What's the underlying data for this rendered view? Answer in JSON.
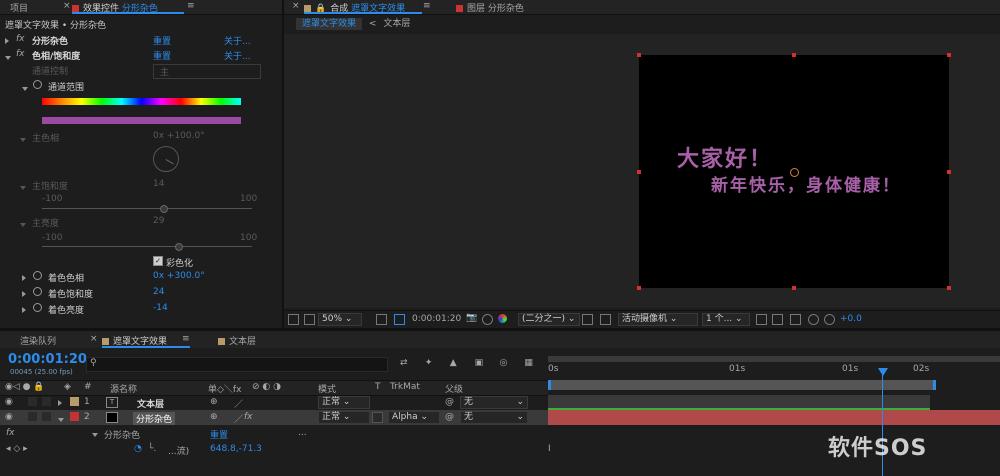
{
  "effects_panel": {
    "tab_project": "项目",
    "tab_effect_controls": "效果控件",
    "tab_layer_name": "分形杂色",
    "menu_glyph": "≡",
    "breadcrumb": "遮罩文字效果 • 分形杂色",
    "effects": [
      {
        "fx": "fx",
        "name": "分形杂色",
        "reset": "重置",
        "about": "关于..."
      },
      {
        "fx": "fx",
        "name": "色相/饱和度",
        "reset": "重置",
        "about": "关于..."
      }
    ],
    "channel_control_label": "通道控制",
    "channel_control_value": "主",
    "channel_range_label": "通道范围",
    "master_hue_label": "主色相",
    "master_hue_value": "0x +100.0°",
    "master_sat_label": "主饱和度",
    "master_sat_value": "14",
    "sat_min": "-100",
    "sat_max": "100",
    "master_light_label": "主亮度",
    "master_light_value": "29",
    "light_min": "-100",
    "light_max": "100",
    "colorize_label": "彩色化",
    "colorize_checked": true,
    "colorize_hue_label": "着色色相",
    "colorize_hue_value": "0x +300.0°",
    "colorize_sat_label": "着色饱和度",
    "colorize_sat_value": "24",
    "colorize_light_label": "着色亮度",
    "colorize_light_value": "-14"
  },
  "comp_panel": {
    "tab_comp_prefix": "合成",
    "tab_comp_name": "遮罩文字效果",
    "menu_glyph": "≡",
    "tab_layer_prefix": "图层",
    "tab_layer_name": "分形杂色",
    "breadcrumb_active": "遮罩文字效果",
    "breadcrumb_next": "文本层",
    "viewer_text_line1": "大家好！",
    "viewer_text_line2": "新年快乐，身体健康！",
    "text_color": "#a860a8",
    "zoom": "50%",
    "timecode": "0:00:01:20",
    "resolution": "(二分之一)",
    "camera": "活动摄像机",
    "views": "1 个...",
    "exposure": "+0.0"
  },
  "timeline": {
    "tab_render_queue": "渲染队列",
    "tab_comp": "遮罩文字效果",
    "menu_glyph": "≡",
    "tab_text_layer": "文本层",
    "timecode": "0:00:01:20",
    "frame_info": "00045 (25.00 fps)",
    "search_placeholder": "",
    "col_source_name": "源名称",
    "col_switches": "单◇＼fx",
    "col_mode": "模式",
    "col_t": "T",
    "col_trkmat": "TrkMat",
    "col_parent": "父级",
    "ruler_labels": [
      "0s",
      "01s",
      "01s",
      "02s"
    ],
    "layers": [
      {
        "num": "1",
        "name": "文本层",
        "mode": "正常",
        "trkmat": "",
        "parent": "无",
        "label_color": "#b99a6a"
      },
      {
        "num": "2",
        "name": "分形杂色",
        "mode": "正常",
        "trkmat": "Alpha",
        "parent": "无",
        "label_color": "#c33333"
      }
    ],
    "sub_effect_fx": "fx",
    "sub_effect_name": "分形杂色",
    "sub_effect_reset": "重置",
    "sub_effect_dots": "...",
    "sub_prop_name": "...流)",
    "sub_prop_value": "648.8,-71.3"
  },
  "watermark": "软件SOS"
}
